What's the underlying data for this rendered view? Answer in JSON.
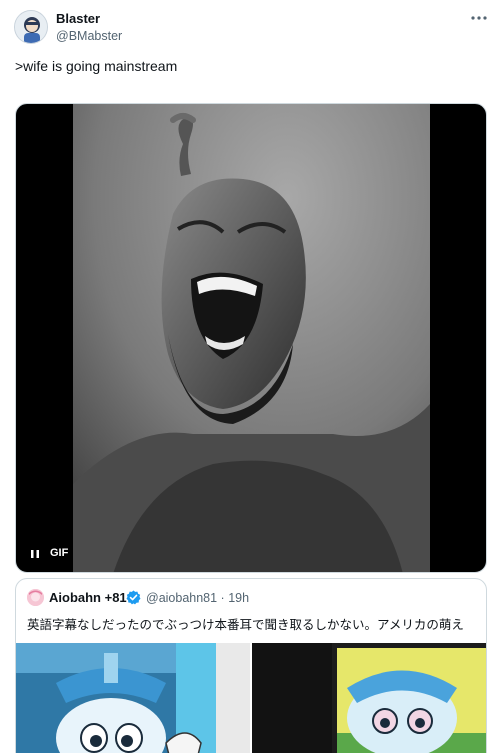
{
  "author": {
    "display_name": "Blaster",
    "handle": "@BMabster"
  },
  "tweet": {
    "text": ">wife is going mainstream"
  },
  "media": {
    "type_label": "GIF",
    "playback_icon": "pause-icon"
  },
  "quoted_tweet": {
    "display_name": "Aiobahn +81",
    "verified_icon": "verified-badge-icon",
    "handle_time": "@aiobahn81 · 19h",
    "text": "英語字幕なしだったのでぶっつけ本番耳で聞き取るしかない。アメリカの萌え"
  },
  "colors": {
    "text_primary": "#0f1419",
    "text_secondary": "#536471",
    "verified_blue": "#1d9bf0",
    "border": "#cfd9de"
  }
}
